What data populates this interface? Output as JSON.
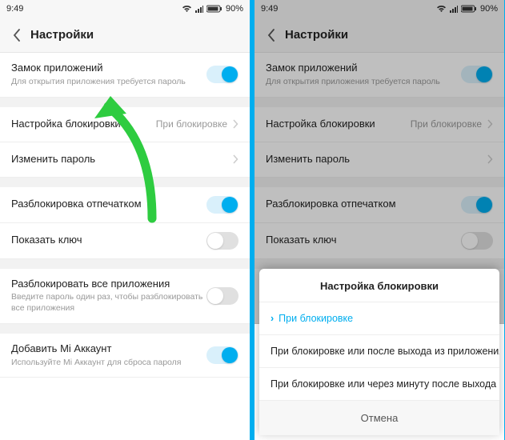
{
  "statusbar": {
    "time": "9:49",
    "battery": "90%"
  },
  "header": {
    "title": "Настройки"
  },
  "rows": {
    "appLock": {
      "label": "Замок приложений",
      "sub": "Для открытия приложения требуется пароль"
    },
    "lockSetting": {
      "label": "Настройка блокировки",
      "value": "При блокировке"
    },
    "changePass": {
      "label": "Изменить пароль"
    },
    "fingerprint": {
      "label": "Разблокировка отпечатком"
    },
    "showKey": {
      "label": "Показать ключ"
    },
    "unlockAll": {
      "label": "Разблокировать все приложения",
      "sub": "Введите пароль один раз, чтобы разблокировать все приложения"
    },
    "miAccount": {
      "label": "Добавить Mi Аккаунт",
      "sub": "Используйте Mi Аккаунт для сброса пароля"
    }
  },
  "modal": {
    "title": "Настройка блокировки",
    "opt1": "При блокировке",
    "opt2": "При блокировке или после выхода из приложения",
    "opt3": "При блокировке или через минуту после выхода из прилож..",
    "cancel": "Отмена"
  }
}
